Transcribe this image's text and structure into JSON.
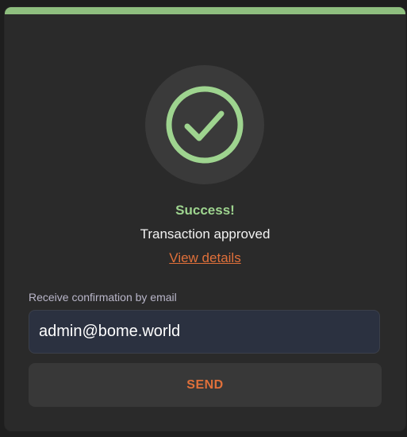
{
  "colors": {
    "accent_bar": "#8fbf7f",
    "success_green": "#9ed48f",
    "link_orange": "#e0703a",
    "card_bg": "#2a2a2a"
  },
  "status": {
    "icon": "check-circle-icon",
    "title": "Success!",
    "message": "Transaction approved",
    "details_link": "View details"
  },
  "confirmation": {
    "label": "Receive confirmation by email",
    "email_value": "admin@bome.world",
    "send_label": "SEND"
  }
}
